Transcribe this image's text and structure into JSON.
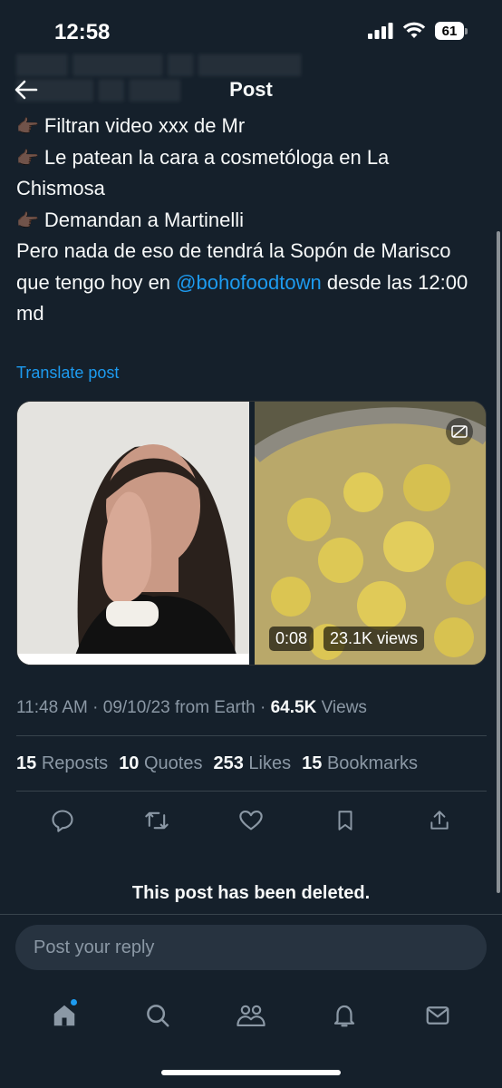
{
  "status_bar": {
    "time": "12:58",
    "battery": "61"
  },
  "header": {
    "title": "Post"
  },
  "tweet": {
    "lines": [
      "Filtran video xxx de Mr",
      "Le patean la cara a cosmetóloga en La Chismosa",
      "Demandan a Martinelli"
    ],
    "body_before_mention": "Pero nada de eso de tendrá la Sopón  de Marisco que tengo hoy en ",
    "mention": "@bohofoodtown",
    "body_after_mention": " desde las 12:00 md"
  },
  "translate_label": "Translate post",
  "media": {
    "video_time": "0:08",
    "video_views": "23.1K views"
  },
  "meta": {
    "time": "11:48 AM",
    "date": "09/10/23",
    "source": "from Earth",
    "views_count": "64.5K",
    "views_label": "Views"
  },
  "stats": {
    "reposts_count": "15",
    "reposts_label": "Reposts",
    "quotes_count": "10",
    "quotes_label": "Quotes",
    "likes_count": "253",
    "likes_label": "Likes",
    "bookmarks_count": "15",
    "bookmarks_label": "Bookmarks"
  },
  "deleted_notice": "This post has been deleted.",
  "reply": {
    "placeholder": "Post your reply"
  },
  "icons": {
    "back": "arrow-left-icon",
    "pointing": "backhand-index-pointing-right-dark-skin-icon",
    "alt": "captions-off-icon"
  },
  "colors": {
    "background": "#15202b",
    "accent": "#1d9bf0",
    "muted": "#8b98a5"
  }
}
